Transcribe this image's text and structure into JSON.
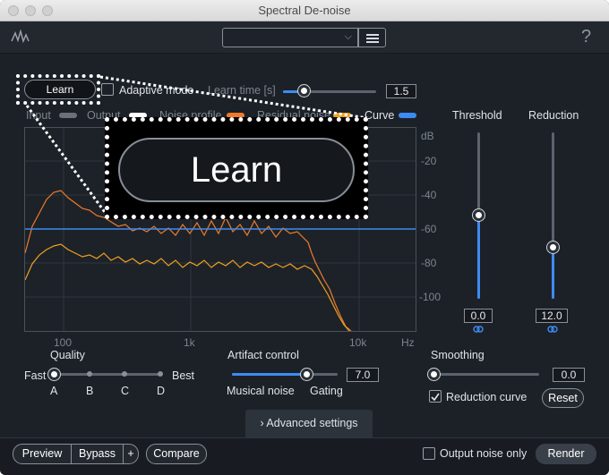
{
  "window": {
    "title": "Spectral De-noise"
  },
  "header": {
    "help": "?"
  },
  "learn": {
    "button": "Learn",
    "adaptive_mode": "Adaptive mode",
    "learn_time_label": "Learn time [s]",
    "learn_time_value": "1.5",
    "learn_time_level": 0.2
  },
  "legend": [
    {
      "label": "Input",
      "color": "#6b7079"
    },
    {
      "label": "Output",
      "color": "#ffffff"
    },
    {
      "label": "Noise profile",
      "color": "#f07a2a"
    },
    {
      "label": "Residual noise",
      "color": "#f0a020"
    },
    {
      "label": "Curve",
      "color": "#3d8bf2"
    }
  ],
  "graph": {
    "db_ticks": [
      "dB",
      "-20",
      "-40",
      "-60",
      "-80",
      "-100"
    ],
    "freq_ticks": [
      "100",
      "1k",
      "10k",
      "Hz"
    ]
  },
  "threshold": {
    "label": "Threshold",
    "value": "0.0",
    "level": 0.5
  },
  "reduction": {
    "label": "Reduction",
    "value": "12.0",
    "level": 0.3
  },
  "quality": {
    "label": "Quality",
    "fast": "Fast",
    "best": "Best",
    "options": [
      "A",
      "B",
      "C",
      "D"
    ],
    "selected": "A"
  },
  "artifact": {
    "label": "Artifact control",
    "value": "7.0",
    "level": 0.7,
    "left": "Musical noise",
    "right": "Gating"
  },
  "smoothing": {
    "label": "Smoothing",
    "value": "0.0",
    "level": 0.0
  },
  "reduction_curve": {
    "label": "Reduction curve",
    "checked": true
  },
  "reset": "Reset",
  "advanced": "Advanced settings",
  "footer": {
    "preview": "Preview",
    "bypass": "Bypass",
    "plus": "+",
    "compare": "Compare",
    "output_noise_only": "Output noise only",
    "render": "Render"
  },
  "zoom": {
    "text": "Learn"
  },
  "colors": {
    "accent": "#3d8bf2",
    "noise": "#f07a2a",
    "residual": "#f0a020",
    "background": "#1c2128"
  }
}
